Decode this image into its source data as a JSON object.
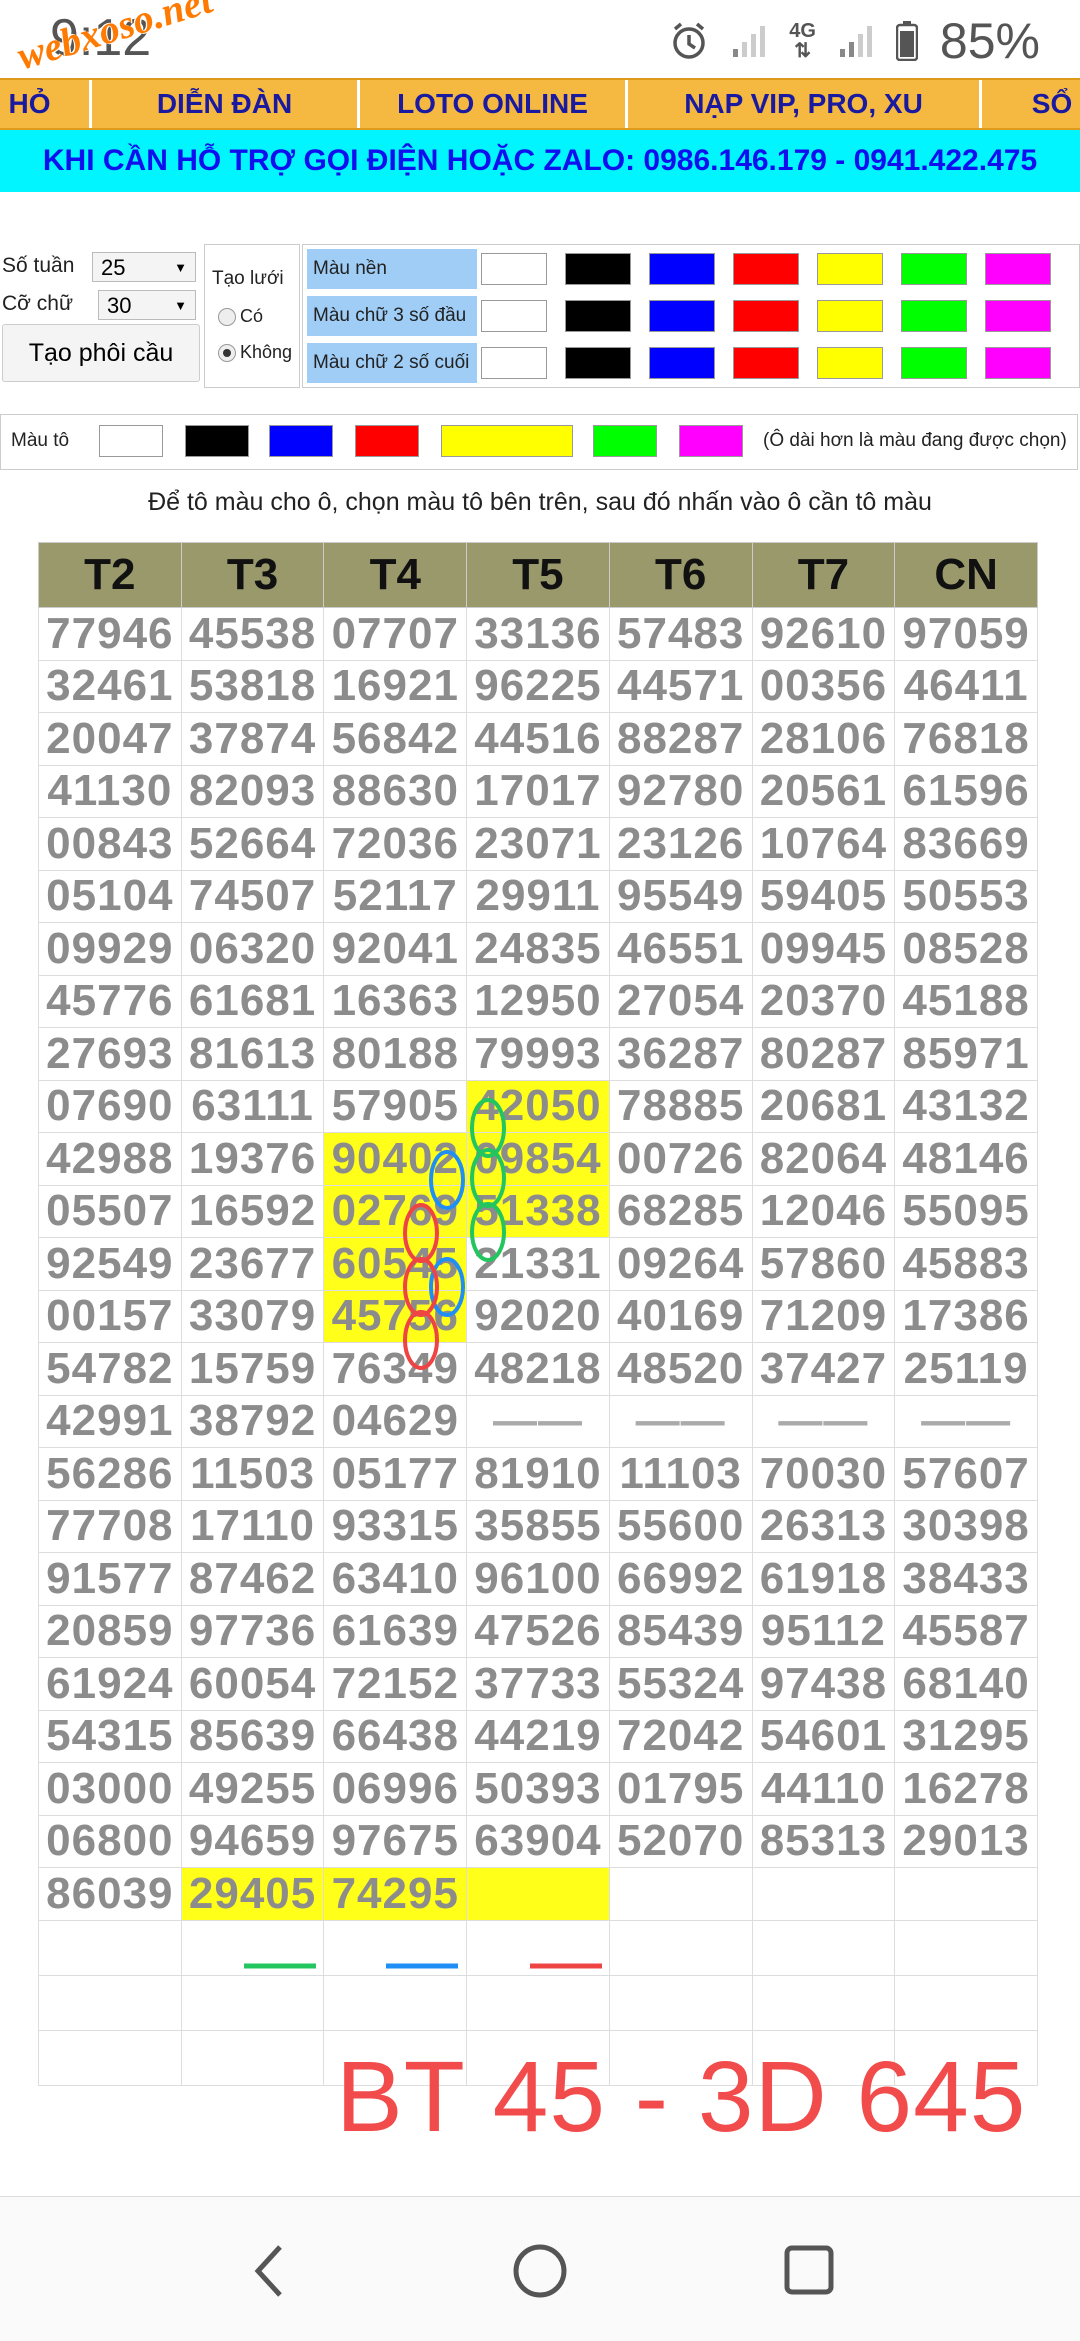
{
  "status_bar": {
    "time": "9:12",
    "network": "4G",
    "battery": "85%",
    "watermark": "webxoso.net"
  },
  "nav": {
    "items": [
      "HỎ",
      "DIỄN ĐÀN",
      "LOTO ONLINE",
      "NẠP VIP, PRO, XU",
      "SỔ"
    ]
  },
  "banner": "KHI CẦN HỖ TRỢ GỌI ĐIỆN HOẶC ZALO: 0986.146.179 - 0941.422.475",
  "controls": {
    "so_tuan_label": "Số tuần",
    "so_tuan_value": "25",
    "co_chu_label": "Cỡ chữ",
    "co_chu_value": "30",
    "tao_phoi_cau": "Tạo phôi cầu",
    "tao_luoi_label": "Tạo lưới",
    "radio_co": "Có",
    "radio_khong": "Không",
    "mau_nen": "Màu nền",
    "mau_chu_3_so_dau": "Màu chữ 3 số đầu",
    "mau_chu_2_so_cuoi": "Màu chữ 2 số cuối",
    "swatch_colors": [
      "#ffffff",
      "#000000",
      "#0000ff",
      "#ff0000",
      "#ffff00",
      "#00ff00",
      "#ff00ff"
    ]
  },
  "mau_to": {
    "label": "Màu tô",
    "note": "(Ô dài hơn là màu đang được chọn)",
    "colors": [
      "#ffffff",
      "#000000",
      "#0000ff",
      "#ff0000",
      "#ffff00",
      "#00ff00",
      "#ff00ff"
    ]
  },
  "instruction": "Để tô màu cho ô, chọn màu tô bên trên, sau đó nhấn vào ô cần tô màu",
  "table": {
    "headers": [
      "T2",
      "T3",
      "T4",
      "T5",
      "T6",
      "T7",
      "CN"
    ],
    "rows": [
      [
        "77946",
        "45538",
        "07707",
        "33136",
        "57483",
        "92610",
        "97059"
      ],
      [
        "32461",
        "53818",
        "16921",
        "96225",
        "44571",
        "00356",
        "46411"
      ],
      [
        "20047",
        "37874",
        "56842",
        "44516",
        "88287",
        "28106",
        "76818"
      ],
      [
        "41130",
        "82093",
        "88630",
        "17017",
        "92780",
        "20561",
        "61596"
      ],
      [
        "00843",
        "52664",
        "72036",
        "23071",
        "23126",
        "10764",
        "83669"
      ],
      [
        "05104",
        "74507",
        "52117",
        "29911",
        "95549",
        "59405",
        "50553"
      ],
      [
        "09929",
        "06320",
        "92041",
        "24835",
        "46551",
        "09945",
        "08528"
      ],
      [
        "45776",
        "61681",
        "16363",
        "12950",
        "27054",
        "20370",
        "45188"
      ],
      [
        "27693",
        "81613",
        "80188",
        "79993",
        "36287",
        "80287",
        "85971"
      ],
      [
        "07690",
        "63111",
        "57905",
        "42050",
        "78885",
        "20681",
        "43132"
      ],
      [
        "42988",
        "19376",
        "90402",
        "09854",
        "00726",
        "82064",
        "48146"
      ],
      [
        "05507",
        "16592",
        "02769",
        "51338",
        "68285",
        "12046",
        "55095"
      ],
      [
        "92549",
        "23677",
        "60545",
        "21331",
        "09264",
        "57860",
        "45883"
      ],
      [
        "00157",
        "33079",
        "45756",
        "92020",
        "40169",
        "71209",
        "17386"
      ],
      [
        "54782",
        "15759",
        "76349",
        "48218",
        "48520",
        "37427",
        "25119"
      ],
      [
        "42991",
        "38792",
        "04629",
        "——",
        "——",
        "——",
        "——"
      ],
      [
        "56286",
        "11503",
        "05177",
        "81910",
        "11103",
        "70030",
        "57607"
      ],
      [
        "77708",
        "17110",
        "93315",
        "35855",
        "55600",
        "26313",
        "30398"
      ],
      [
        "91577",
        "87462",
        "63410",
        "96100",
        "66992",
        "61918",
        "38433"
      ],
      [
        "20859",
        "97736",
        "61639",
        "47526",
        "85439",
        "95112",
        "45587"
      ],
      [
        "61924",
        "60054",
        "72152",
        "37733",
        "55324",
        "97438",
        "68140"
      ],
      [
        "54315",
        "85639",
        "66438",
        "44219",
        "72042",
        "54601",
        "31295"
      ],
      [
        "03000",
        "49255",
        "06996",
        "50393",
        "01795",
        "44110",
        "16278"
      ],
      [
        "06800",
        "94659",
        "97675",
        "63904",
        "52070",
        "85313",
        "29013"
      ],
      [
        "86039",
        "29405",
        "74295",
        "",
        "",
        "",
        ""
      ]
    ]
  },
  "annotation_text": "BT 45 - 3D 645"
}
